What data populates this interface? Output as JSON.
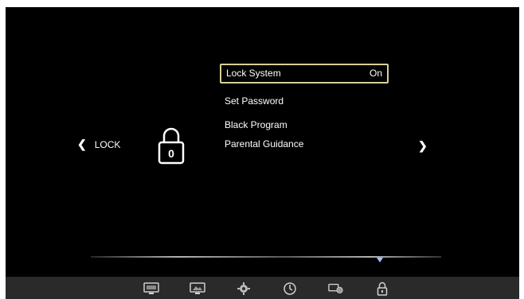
{
  "nav": {
    "left_label": "LOCK"
  },
  "menu": {
    "items": [
      {
        "label": "Lock System",
        "value": "On"
      },
      {
        "label": "Set Password"
      },
      {
        "label": "Black Program"
      },
      {
        "label": "Parental Guidance"
      }
    ]
  },
  "bottom_bar": {
    "icons": [
      "picture-icon",
      "screen-icon",
      "settings-icon",
      "clock-icon",
      "option-icon",
      "lock-icon"
    ]
  },
  "lock_icon": {
    "digit": "0"
  }
}
